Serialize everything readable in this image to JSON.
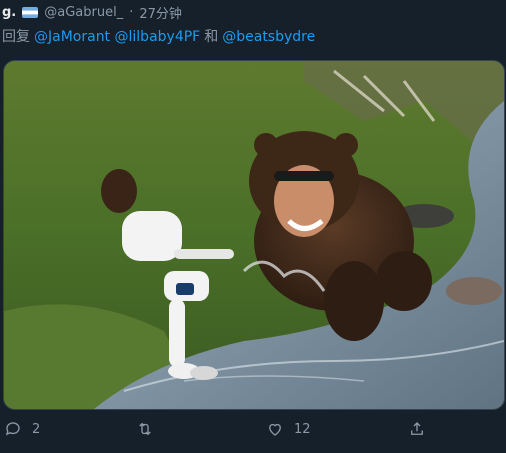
{
  "tweet": {
    "display_name": "g.",
    "handle": "@aGabruel_",
    "separator": "·",
    "time": "27分钟",
    "reply_label": "回复",
    "mentions": [
      "@JaMorant",
      "@lilbaby4PF"
    ],
    "mention_conj": "和",
    "mention_last": "@beatsbydre"
  },
  "media": {
    "description_icon": "meme-image"
  },
  "actions": {
    "reply_count": "2",
    "retweet_count": "",
    "like_count": "12",
    "share_count": ""
  },
  "colors": {
    "background": "#15202b",
    "text": "#e7e9ea",
    "muted": "#8b98a5",
    "link": "#1d9bf0"
  }
}
